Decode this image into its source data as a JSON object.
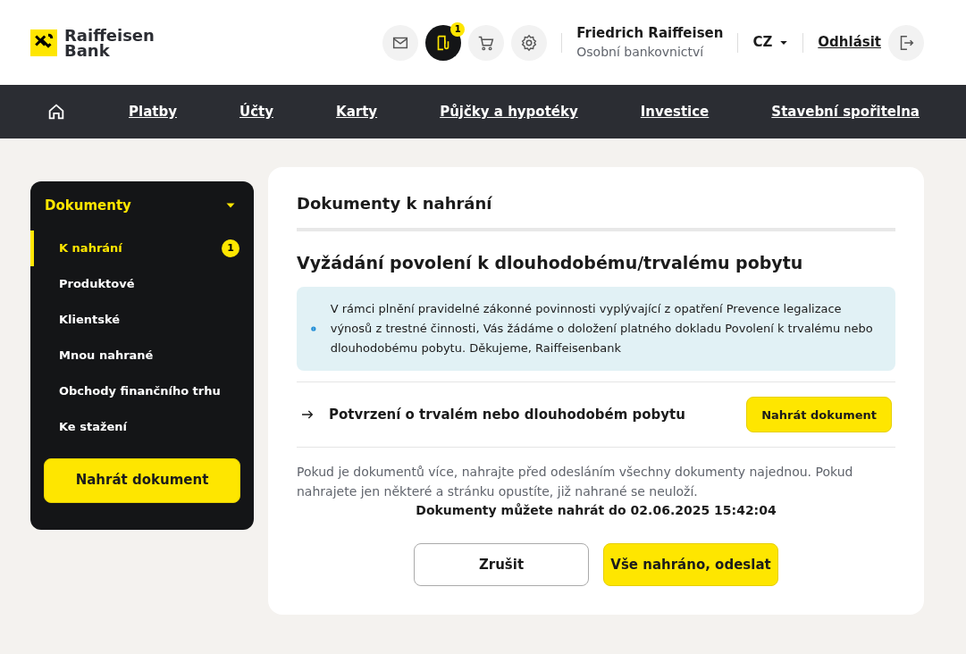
{
  "header": {
    "logo": {
      "line_1": "Raiffeisen",
      "line_2": "Bank"
    },
    "icons": [
      {
        "kind": "mail",
        "selected": false
      },
      {
        "kind": "documents",
        "selected": true,
        "badge": "1"
      },
      {
        "kind": "cart",
        "selected": false
      },
      {
        "kind": "settings",
        "selected": false
      }
    ],
    "user": {
      "name": "Friedrich Raiffeisen",
      "subtitle": "Osobní bankovnictví"
    },
    "language": "CZ",
    "logout": "Odhlásit"
  },
  "nav": {
    "items": [
      "Platby",
      "Účty",
      "Karty",
      "Půjčky a hypotéky",
      "Investice",
      "Stavební spořitelna"
    ]
  },
  "sidebar": {
    "title": "Dokumenty",
    "expanded": true,
    "items": [
      {
        "label": "K nahrání",
        "selected": true,
        "badge": "1"
      },
      {
        "label": "Produktové",
        "selected": false
      },
      {
        "label": "Klientské",
        "selected": false
      },
      {
        "label": "Mnou nahrané",
        "selected": false
      },
      {
        "label": "Obchody finančního trhu",
        "selected": false
      },
      {
        "label": "Ke stažení",
        "selected": false
      }
    ],
    "button": "Nahrát dokument"
  },
  "main": {
    "title": "Dokumenty k nahrání",
    "subtitle": "Vyžádání povolení k dlouhodobému/trvalému pobytu",
    "info": "V rámci plnění pravidelné zákonné povinnosti vyplývající z opatření Prevence legalizace výnosů z trestné činnosti, Vás žádáme o doložení platného dokladu Povolení k trvalému nebo dlouhodobému pobytu. Děkujeme, Raiffeisenbank",
    "documents": [
      {
        "label": "Potvrzení o trvalém nebo dlouhodobém pobytu",
        "button": "Nahrát dokument"
      }
    ],
    "note": "Pokud je dokumentů více, nahrajte před odesláním všechny dokumenty najednou. Pokud nahrajete jen některé a stránku opustíte, již nahrané se neuloží.",
    "deadline": "Dokumenty můžete nahrát do 02.06.2025 15:42:04",
    "cancel": "Zrušit",
    "submit": "Vše nahráno, odeslat"
  }
}
